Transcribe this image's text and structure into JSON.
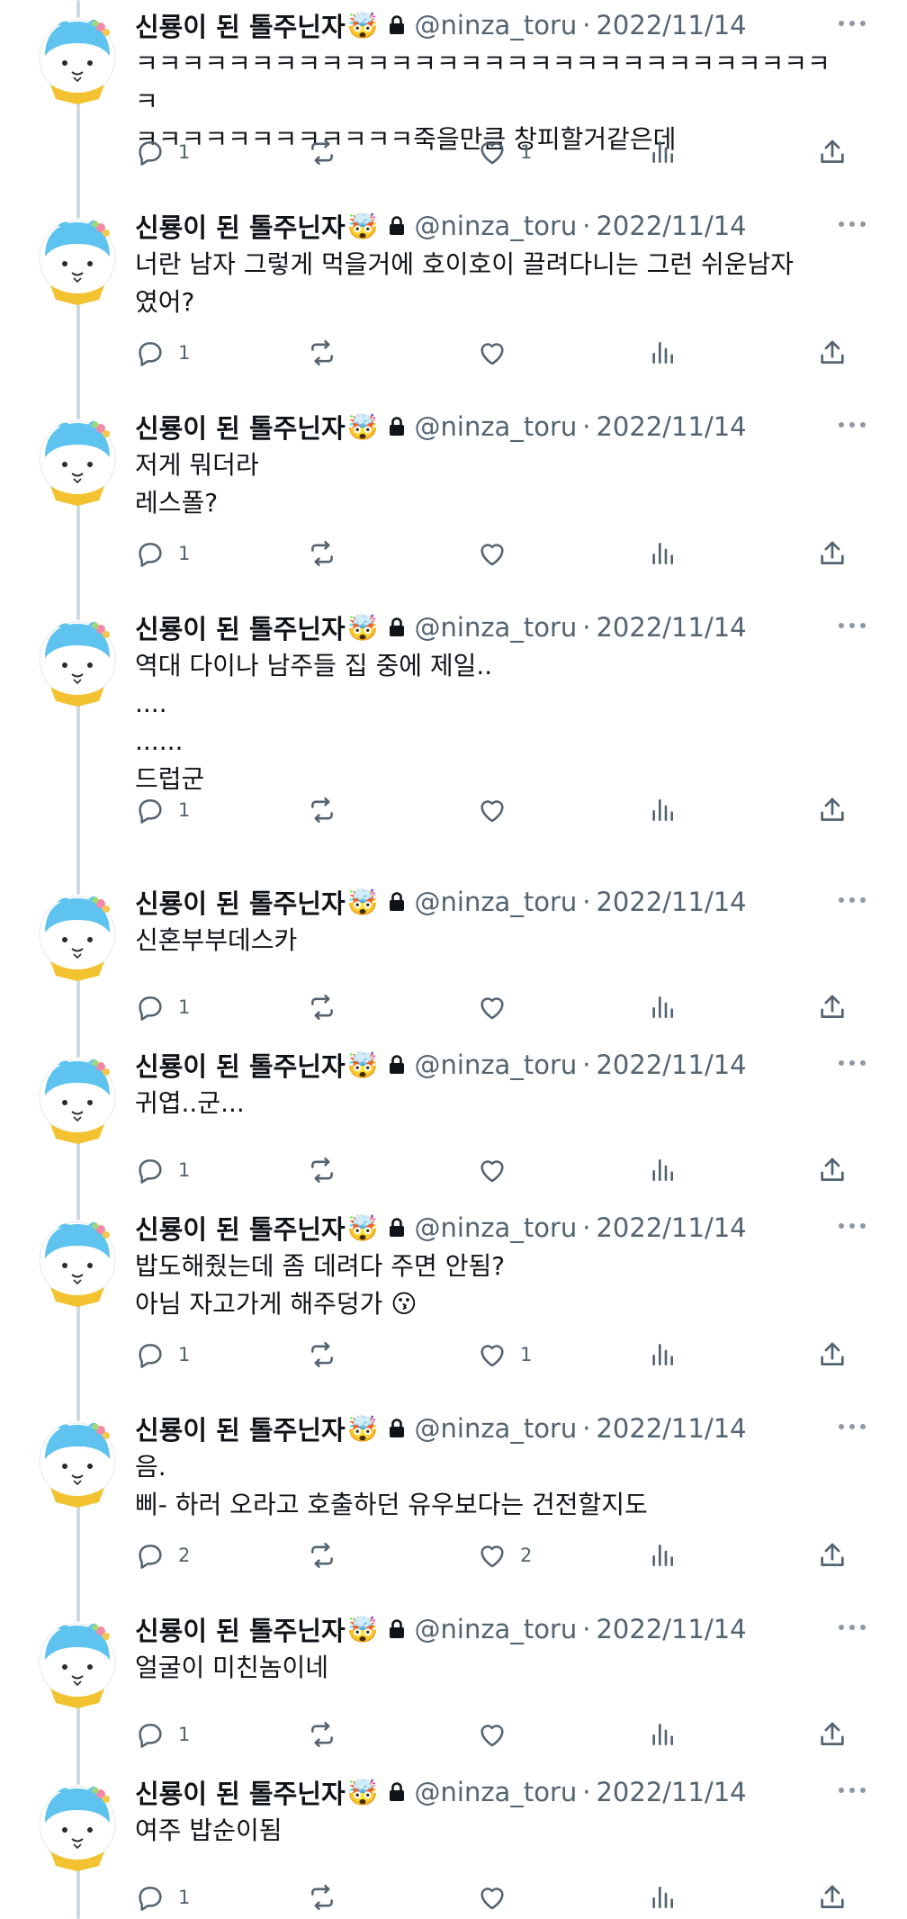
{
  "author": {
    "name": "신룡이 된 톨주닌자",
    "badge_emoji": "🤯",
    "handle": "@ninza_toru",
    "separator": "·"
  },
  "colors": {
    "text": "#0f1419",
    "secondary": "#536471",
    "thread_line": "#cfd9de",
    "avatar_blue": "#5ec3ef",
    "avatar_scarf": "#f2c230"
  },
  "icons": [
    "reply-icon",
    "retweet-icon",
    "like-icon",
    "views-icon",
    "share-icon",
    "lock-icon",
    "more-icon"
  ],
  "tweets": [
    {
      "date": "2022/11/14",
      "text": "ㅋㅋㅋㅋㅋㅋㅋㅋㅋㅋㅋㅋㅋㅋㅋㅋㅋㅋㅋㅋㅋㅋㅋㅋㅋㅋㅋㅋㅋㅋㅋ\nㅋㅋㅋㅋㅋㅋㅋㅋㅋㅋㅋㅋ죽을만큼 창피할거같은데",
      "replies": "1",
      "retweets": "",
      "likes": "1"
    },
    {
      "date": "2022/11/14",
      "text": "너란 남자 그렇게 먹을거에 호이호이 끌려다니는 그런 쉬운남자\n였어?",
      "replies": "1",
      "retweets": "",
      "likes": ""
    },
    {
      "date": "2022/11/14",
      "text": "저게 뭐더라\n레스폴?",
      "replies": "1",
      "retweets": "",
      "likes": ""
    },
    {
      "date": "2022/11/14",
      "text": "역대 다이나 남주들 집 중에 제일..\n....\n......\n드럽군",
      "replies": "1",
      "retweets": "",
      "likes": ""
    },
    {
      "date": "2022/11/14",
      "text": "신혼부부데스카",
      "replies": "1",
      "retweets": "",
      "likes": ""
    },
    {
      "date": "2022/11/14",
      "text": "귀엽..군...",
      "replies": "1",
      "retweets": "",
      "likes": ""
    },
    {
      "date": "2022/11/14",
      "text": "밥도해줬는데 좀 데려다 주면 안됨?\n아님 자고가게 해주덩가 😗",
      "replies": "1",
      "retweets": "",
      "likes": "1"
    },
    {
      "date": "2022/11/14",
      "text": "음.\n삐- 하러 오라고 호출하던 유우보다는 건전할지도",
      "replies": "2",
      "retweets": "",
      "likes": "2"
    },
    {
      "date": "2022/11/14",
      "text": "얼굴이 미친놈이네",
      "replies": "1",
      "retweets": "",
      "likes": ""
    },
    {
      "date": "2022/11/14",
      "text": "여주 밥순이됨",
      "replies": "1",
      "retweets": "",
      "likes": ""
    }
  ]
}
